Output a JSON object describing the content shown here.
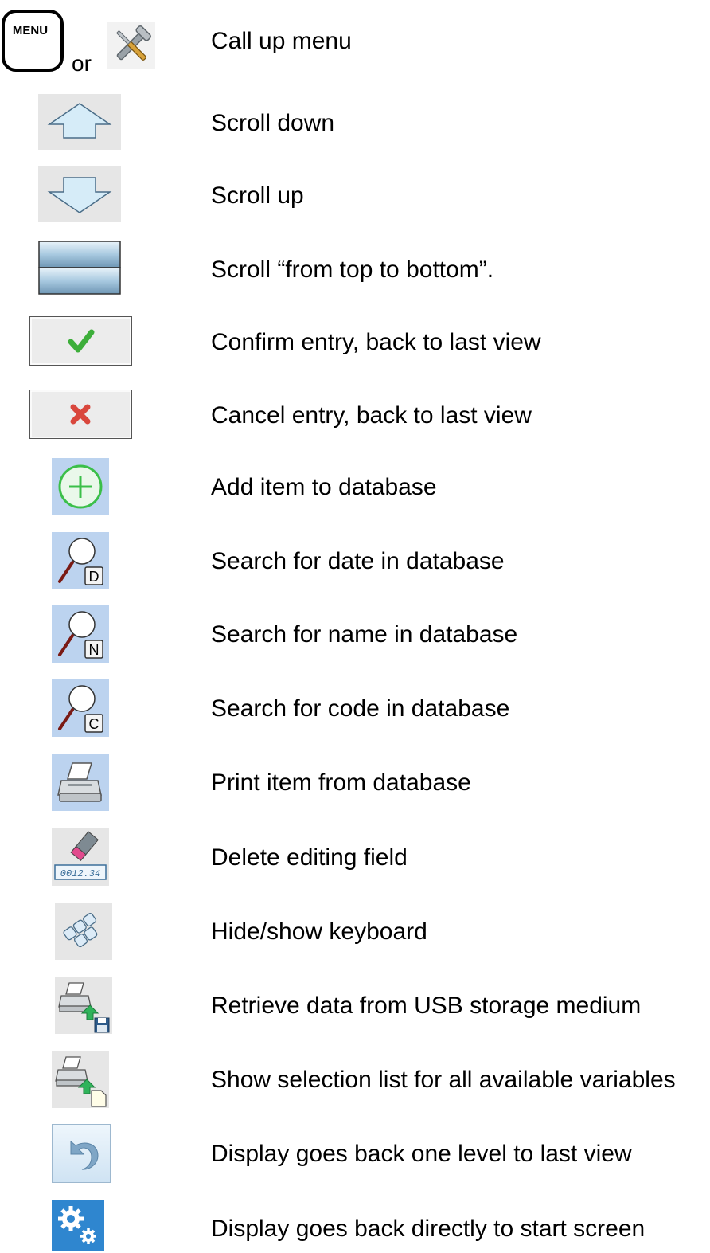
{
  "menu": {
    "key_text": "MENU",
    "or_text": "or",
    "label": "Call up menu"
  },
  "rows": [
    {
      "icon": "arrow-up-icon",
      "label": "Scroll down"
    },
    {
      "icon": "arrow-down-icon",
      "label": "Scroll up"
    },
    {
      "icon": "scroll-bars-icon",
      "label": " Scroll “from top to bottom”."
    },
    {
      "icon": "checkmark-icon",
      "label": "Confirm entry, back to last view"
    },
    {
      "icon": "cross-icon",
      "label": "Cancel entry, back to last view"
    },
    {
      "icon": "plus-circle-icon",
      "label": "Add item to database"
    },
    {
      "icon": "search-date-icon",
      "letter": "D",
      "label": "Search for date in database"
    },
    {
      "icon": "search-name-icon",
      "letter": "N",
      "label": "Search for name in database"
    },
    {
      "icon": "search-code-icon",
      "letter": "C",
      "label": "Search for code in database"
    },
    {
      "icon": "printer-icon",
      "label": "Print item from database"
    },
    {
      "icon": "eraser-icon",
      "display_text": "0012.34",
      "label": "Delete editing field"
    },
    {
      "icon": "keyboard-icon",
      "label": "Hide/show keyboard"
    },
    {
      "icon": "usb-retrieve-icon",
      "label": "Retrieve data from USB storage medium"
    },
    {
      "icon": "variables-list-icon",
      "label": "Show selection list for all available variables"
    },
    {
      "icon": "back-arrow-icon",
      "label": "Display goes back one level to last view"
    },
    {
      "icon": "home-gears-icon",
      "label": "Display goes back directly to start screen"
    }
  ],
  "colors": {
    "tile_blue": "#bcd3ef",
    "arrow_fill": "#d6ecf8",
    "check_green": "#3dae3a",
    "cross_red": "#d9473d",
    "plus_green": "#3bbf49"
  }
}
